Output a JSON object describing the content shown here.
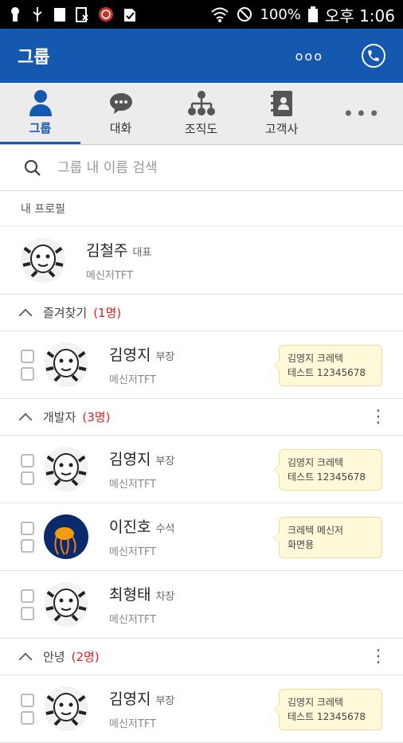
{
  "status_bar": {
    "battery": "100%",
    "time": "오후 1:06"
  },
  "app_bar": {
    "title": "그룹",
    "more": "ooo"
  },
  "tabs": [
    {
      "label": "그룹",
      "icon": "person-icon",
      "active": true
    },
    {
      "label": "대화",
      "icon": "chat-icon",
      "active": false
    },
    {
      "label": "조직도",
      "icon": "org-chart-icon",
      "active": false
    },
    {
      "label": "고객사",
      "icon": "contacts-book-icon",
      "active": false
    },
    {
      "label": "•••",
      "icon": "more-icon",
      "active": false
    }
  ],
  "search": {
    "placeholder": "그룹 내 이름 검색"
  },
  "my_profile": {
    "label": "내 프로필",
    "name": "김철주",
    "rank": "대표",
    "org": "메신저TFT"
  },
  "groups": [
    {
      "title": "즐겨찾기",
      "count": "(1명)",
      "has_menu": false,
      "members": [
        {
          "name": "김영지",
          "rank": "부장",
          "org": "메신저TFT",
          "status": "김영지 크레텍\n테스트 12345678",
          "avatar": "monkey"
        }
      ]
    },
    {
      "title": "개발자",
      "count": "(3명)",
      "has_menu": true,
      "members": [
        {
          "name": "김영지",
          "rank": "부장",
          "org": "메신저TFT",
          "status": "김영지 크레텍\n테스트 12345678",
          "avatar": "monkey"
        },
        {
          "name": "이진호",
          "rank": "수석",
          "org": "메신저TFT",
          "status": "크레텍 메신저\n화면용",
          "avatar": "jellyfish"
        },
        {
          "name": "최형태",
          "rank": "차장",
          "org": "메신저TFT",
          "status": "",
          "avatar": "monkey"
        }
      ]
    },
    {
      "title": "안녕",
      "count": "(2명)",
      "has_menu": true,
      "members": [
        {
          "name": "김영지",
          "rank": "부장",
          "org": "메신저TFT",
          "status": "김영지 크레텍\n테스트 12345678",
          "avatar": "monkey"
        }
      ]
    }
  ],
  "colors": {
    "brand": "#1558b0",
    "count": "#e02020",
    "bubble": "#fff8d9"
  }
}
